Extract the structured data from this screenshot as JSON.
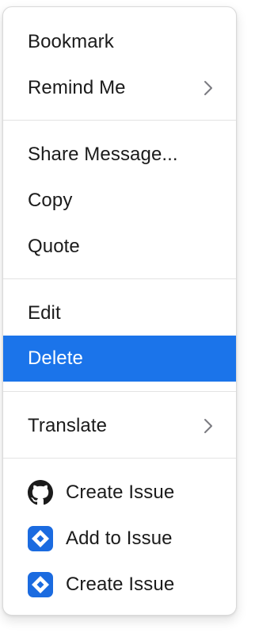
{
  "menu": {
    "items": [
      {
        "label": "Bookmark"
      },
      {
        "label": "Remind Me",
        "chevron": "chevron-right-icon"
      },
      {
        "label": "Share Message..."
      },
      {
        "label": "Copy"
      },
      {
        "label": "Quote"
      },
      {
        "label": "Edit"
      },
      {
        "label": "Delete"
      },
      {
        "label": "Translate",
        "chevron": "chevron-right-icon"
      },
      {
        "label": "Create Issue",
        "icon": "github-icon"
      },
      {
        "label": "Add to Issue",
        "icon": "jira-icon"
      },
      {
        "label": "Create Issue",
        "icon": "jira-icon"
      }
    ]
  },
  "colors": {
    "highlight": "#1b74ea",
    "jira": "#1b6be0"
  }
}
